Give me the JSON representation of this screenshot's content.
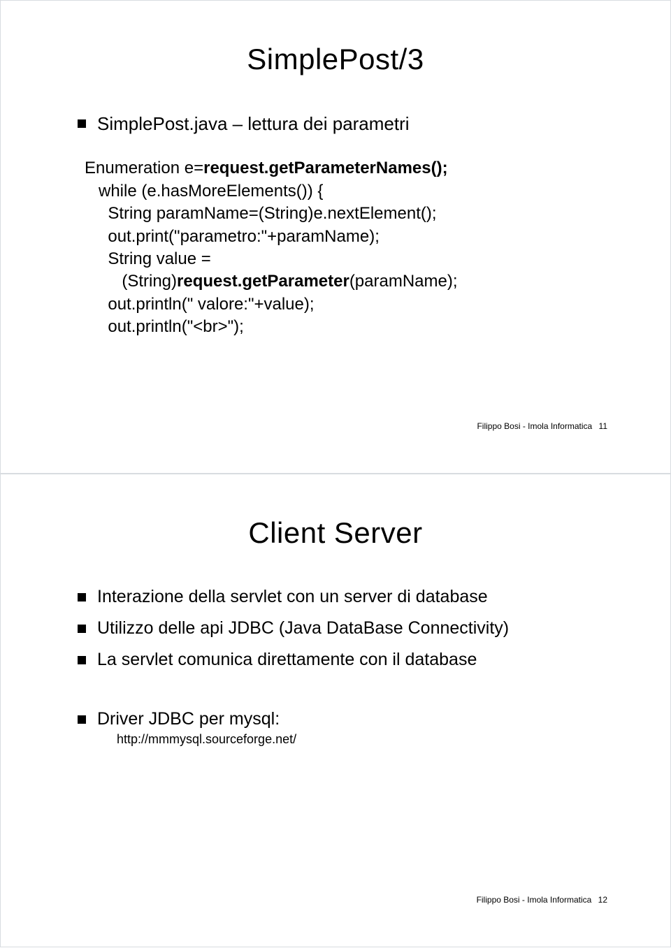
{
  "slide1": {
    "title": "SimplePost/3",
    "bullet1": "SimplePost.java – lettura dei parametri",
    "code_l1a": "Enumeration e=",
    "code_l1b": "request.getParameterNames();",
    "code_l2": "   while (e.hasMoreElements()) {",
    "code_l3": "     String paramName=(String)e.nextElement();",
    "code_l4": "     out.print(\"parametro:\"+paramName);",
    "code_l5": "     String value =",
    "code_l6a": "        (String)",
    "code_l6b": "request.getParameter",
    "code_l6c": "(paramName);",
    "code_l7": "     out.println(\" valore:\"+value);",
    "code_l8": "     out.println(\"<br>\");",
    "footer_text": "Filippo Bosi - Imola Informatica",
    "footer_page": "11"
  },
  "slide2": {
    "title": "Client Server",
    "bullet1": "Interazione della servlet con un server di database",
    "bullet2": "Utilizzo delle api JDBC (Java DataBase Connectivity)",
    "bullet3": "La servlet comunica direttamente con il database",
    "bullet4": "Driver JDBC per mysql:",
    "bullet4_sub": "http://mmmysql.sourceforge.net/",
    "footer_text": "Filippo Bosi - Imola Informatica",
    "footer_page": "12"
  }
}
